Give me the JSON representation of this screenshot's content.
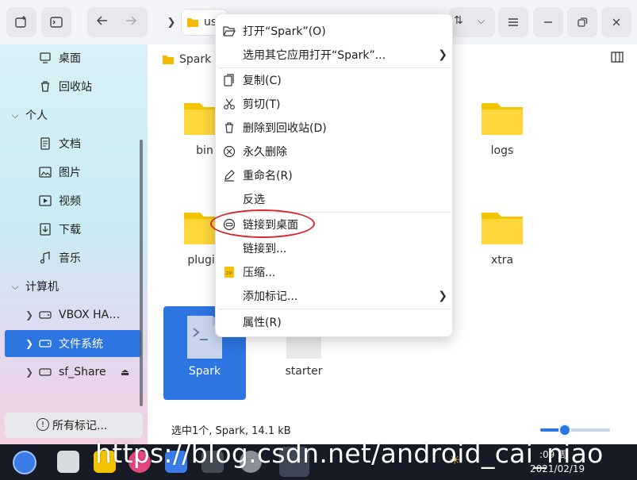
{
  "toolbar": {
    "address_text": "usr",
    "buttons": [
      "new-tab",
      "terminal",
      "back",
      "forward",
      "sort",
      "dropdown",
      "menu",
      "minimize",
      "maximize",
      "close"
    ]
  },
  "sidebar": {
    "items": [
      {
        "label": "桌面",
        "icon": "desktop-icon"
      },
      {
        "label": "回收站",
        "icon": "trash-icon"
      },
      {
        "label": "个人",
        "group": true
      },
      {
        "label": "文档",
        "icon": "document-icon"
      },
      {
        "label": "图片",
        "icon": "picture-icon"
      },
      {
        "label": "视频",
        "icon": "video-icon"
      },
      {
        "label": "下载",
        "icon": "download-icon"
      },
      {
        "label": "音乐",
        "icon": "music-icon"
      },
      {
        "label": "计算机",
        "group": true
      },
      {
        "label": "VBOX HA…",
        "icon": "drive-icon"
      },
      {
        "label": "文件系统",
        "icon": "drive-icon",
        "selected": true
      },
      {
        "label": "sf_Share",
        "icon": "folder-icon"
      }
    ],
    "tags_button": "所有标记..."
  },
  "main": {
    "breadcrumb": "Spark",
    "files": [
      {
        "name": "bin",
        "type": "folder"
      },
      {
        "name": "logs",
        "type": "folder"
      },
      {
        "name": "plugin",
        "type": "folder"
      },
      {
        "name": "xtra",
        "type": "folder"
      },
      {
        "name": "Spark",
        "type": "script",
        "selected": true
      },
      {
        "name": "starter",
        "type": "file"
      }
    ],
    "status": "选中1个, Spark, 14.1 kB",
    "zoom_level": 0.35
  },
  "context_menu": {
    "items": [
      {
        "label": "打开“Spark”(O)",
        "icon": "open-folder-icon"
      },
      {
        "label": "选用其它应用打开“Spark”...",
        "submenu": true
      },
      {
        "label": "复制(C)",
        "icon": "copy-icon"
      },
      {
        "label": "剪切(T)",
        "icon": "cut-icon"
      },
      {
        "label": "删除到回收站(D)",
        "icon": "trash-icon"
      },
      {
        "label": "永久删除",
        "icon": "delete-circle-icon"
      },
      {
        "label": "重命名(R)",
        "icon": "rename-icon"
      },
      {
        "label": "反选"
      },
      {
        "label": "链接到桌面",
        "icon": "link-icon",
        "highlighted": true
      },
      {
        "label": "链接到..."
      },
      {
        "label": "压缩...",
        "icon": "zip-icon"
      },
      {
        "label": "添加标记...",
        "submenu": true
      },
      {
        "label": "属性(R)"
      }
    ]
  },
  "taskbar": {
    "clock_time": ":09 周",
    "clock_date": "2021/02/19",
    "watermark": "https://blog.csdn.net/android_cai_niao"
  },
  "colors": {
    "accent": "#2d75e0",
    "annotation": "#d9262a",
    "taskbar": "#161b26"
  }
}
